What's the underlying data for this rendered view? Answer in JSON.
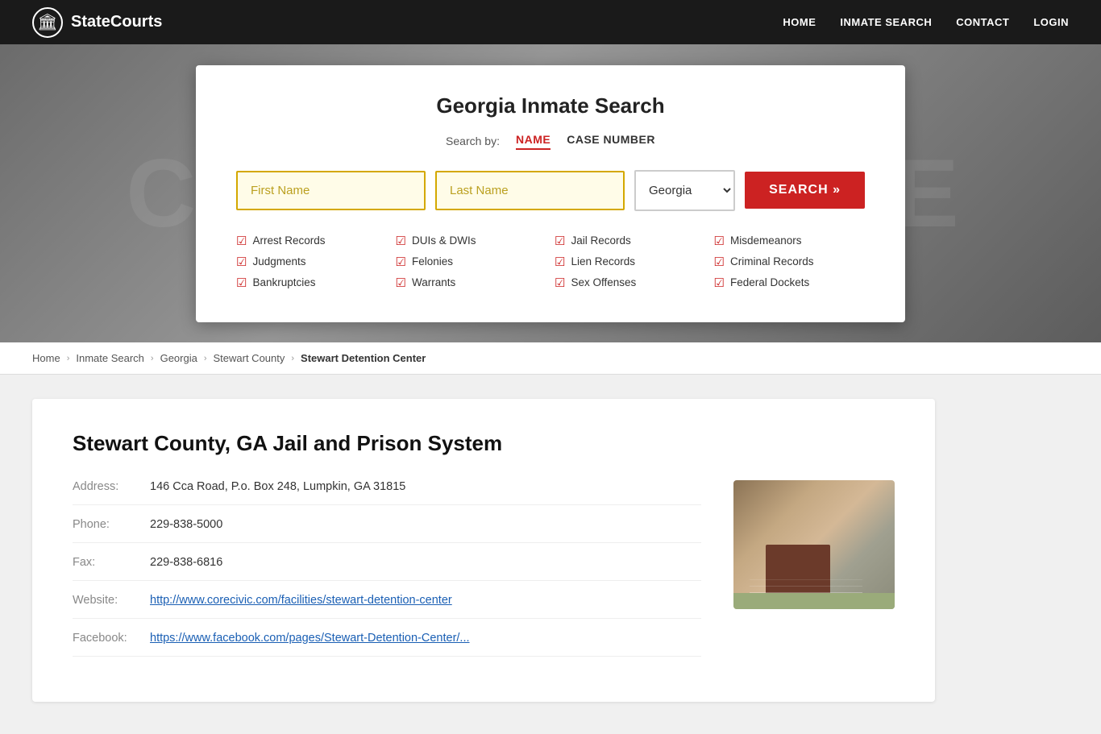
{
  "header": {
    "logo_text": "StateCourts",
    "logo_icon": "🏛",
    "nav": {
      "home": "HOME",
      "inmate_search": "INMATE SEARCH",
      "contact": "CONTACT",
      "login": "LOGIN"
    }
  },
  "hero": {
    "bg_text": "COURTHOUSE"
  },
  "search_card": {
    "title": "Georgia Inmate Search",
    "search_by_label": "Search by:",
    "tab_name": "NAME",
    "tab_case_number": "CASE NUMBER",
    "first_name_placeholder": "First Name",
    "last_name_placeholder": "Last Name",
    "state_value": "Georgia",
    "search_button": "SEARCH »",
    "checkboxes": [
      "Arrest Records",
      "DUIs & DWIs",
      "Jail Records",
      "Misdemeanors",
      "Judgments",
      "Felonies",
      "Lien Records",
      "Criminal Records",
      "Bankruptcies",
      "Warrants",
      "Sex Offenses",
      "Federal Dockets"
    ]
  },
  "breadcrumb": {
    "items": [
      "Home",
      "Inmate Search",
      "Georgia",
      "Stewart County",
      "Stewart Detention Center"
    ]
  },
  "facility": {
    "title": "Stewart County, GA Jail and Prison System",
    "address_label": "Address:",
    "address_value": "146 Cca Road, P.o. Box 248, Lumpkin, GA 31815",
    "phone_label": "Phone:",
    "phone_value": "229-838-5000",
    "fax_label": "Fax:",
    "fax_value": "229-838-6816",
    "website_label": "Website:",
    "website_value": "http://www.corecivic.com/facilities/stewart-detention-center",
    "facebook_label": "Facebook:",
    "facebook_value": "https://www.facebook.com/pages/Stewart-Detention-Center/..."
  }
}
